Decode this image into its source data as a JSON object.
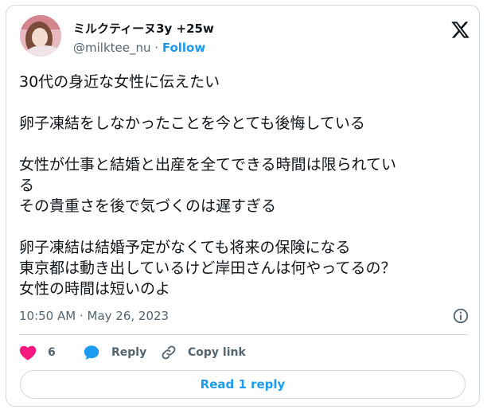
{
  "author": {
    "display_name": "ミルクティーヌ3y +25w",
    "handle": "@milktee_nu",
    "separator": " · ",
    "follow_label": "Follow"
  },
  "tweet": {
    "lines": [
      "30代の身近な女性に伝えたい",
      "卵子凍結をしなかったことを今とても後悔している",
      "女性が仕事と結婚と出産を全てできる時間は限られてい",
      "る",
      "その貴重さを後で気づくのは遅すぎる",
      "卵子凍結は結婚予定がなくても将来の保険になる",
      "東京都は動き出しているけど岸田さんは何やってるの？",
      "女性の時間は短いのよ"
    ],
    "timestamp": "10:50 AM · May 26, 2023"
  },
  "actions": {
    "like_count": "6",
    "reply_label": "Reply",
    "copy_link_label": "Copy link"
  },
  "read_replies_label": "Read 1 reply",
  "colors": {
    "like": "#f91880",
    "reply": "#1d9bf0",
    "link": "#1d9bf0",
    "muted": "#536471",
    "border": "#cfd9de"
  },
  "icons": [
    "x-logo-icon",
    "info-icon",
    "heart-icon",
    "reply-bubble-icon",
    "link-icon"
  ]
}
